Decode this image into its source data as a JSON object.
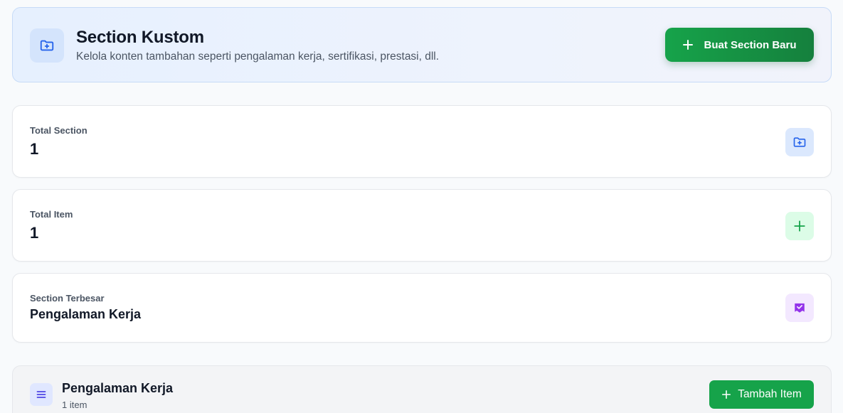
{
  "header": {
    "title": "Section Kustom",
    "subtitle": "Kelola konten tambahan seperti pengalaman kerja, sertifikasi, prestasi, dll.",
    "icon": "folder-plus-icon",
    "new_section_button": "Buat Section Baru"
  },
  "stats": [
    {
      "label": "Total Section",
      "value": "1",
      "icon": "folder-plus-icon",
      "color": "#2563eb"
    },
    {
      "label": "Total Item",
      "value": "1",
      "icon": "plus-icon",
      "color": "#16a34a"
    },
    {
      "label": "Section Terbesar",
      "value": "Pengalaman Kerja",
      "icon": "badge-check-icon",
      "color": "#9333ea"
    }
  ],
  "sections": [
    {
      "title": "Pengalaman Kerja",
      "count": "1 item",
      "icon": "list-icon",
      "add_button": "Tambah Item"
    }
  ],
  "colors": {
    "primary_green": "#16a34a",
    "accent_blue": "#2563eb",
    "accent_purple": "#9333ea",
    "accent_indigo": "#4f46e5"
  }
}
